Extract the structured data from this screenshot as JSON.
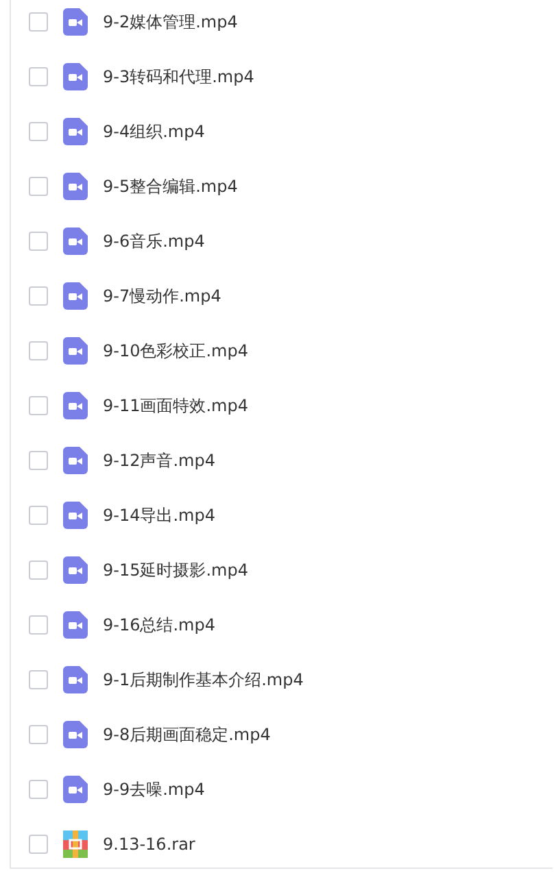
{
  "files": [
    {
      "name": "9-2媒体管理.mp4",
      "kind": "video",
      "checked": false
    },
    {
      "name": "9-3转码和代理.mp4",
      "kind": "video",
      "checked": false
    },
    {
      "name": "9-4组织.mp4",
      "kind": "video",
      "checked": false
    },
    {
      "name": "9-5整合编辑.mp4",
      "kind": "video",
      "checked": false
    },
    {
      "name": "9-6音乐.mp4",
      "kind": "video",
      "checked": false
    },
    {
      "name": "9-7慢动作.mp4",
      "kind": "video",
      "checked": false
    },
    {
      "name": "9-10色彩校正.mp4",
      "kind": "video",
      "checked": false
    },
    {
      "name": "9-11画面特效.mp4",
      "kind": "video",
      "checked": false
    },
    {
      "name": "9-12声音.mp4",
      "kind": "video",
      "checked": false
    },
    {
      "name": "9-14导出.mp4",
      "kind": "video",
      "checked": false
    },
    {
      "name": "9-15延时摄影.mp4",
      "kind": "video",
      "checked": false
    },
    {
      "name": "9-16总结.mp4",
      "kind": "video",
      "checked": false
    },
    {
      "name": "9-1后期制作基本介绍.mp4",
      "kind": "video",
      "checked": false
    },
    {
      "name": "9-8后期画面稳定.mp4",
      "kind": "video",
      "checked": false
    },
    {
      "name": "9-9去噪.mp4",
      "kind": "video",
      "checked": false
    },
    {
      "name": "9.13-16.rar",
      "kind": "archive",
      "checked": false
    }
  ]
}
